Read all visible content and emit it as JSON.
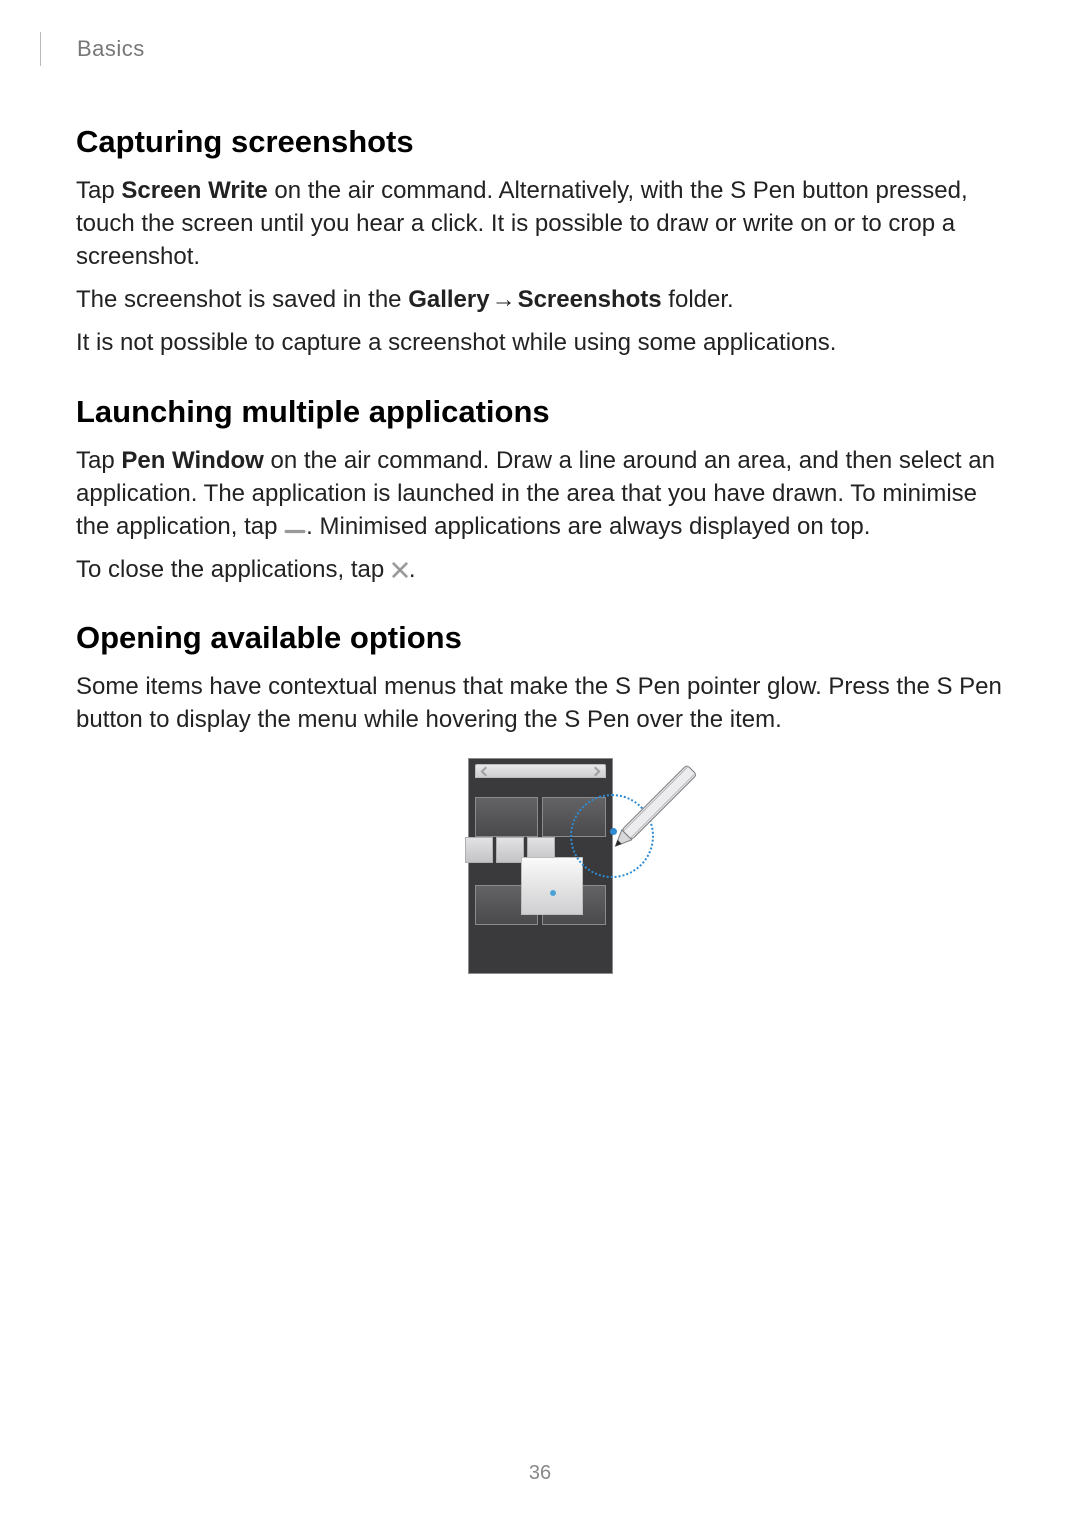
{
  "breadcrumb": "Basics",
  "sections": {
    "capture": {
      "heading": "Capturing screenshots",
      "p1_pre": "Tap ",
      "p1_bold": "Screen Write",
      "p1_post": " on the air command. Alternatively, with the S Pen button pressed, touch the screen until you hear a click. It is possible to draw or write on or to crop a screenshot.",
      "p2_pre": "The screenshot is saved in the ",
      "p2_b1": "Gallery",
      "p2_arrow": " → ",
      "p2_b2": "Screenshots",
      "p2_post": " folder.",
      "p3": "It is not possible to capture a screenshot while using some applications."
    },
    "launch": {
      "heading": "Launching multiple applications",
      "p1_pre": "Tap ",
      "p1_bold": "Pen Window",
      "p1_mid": " on the air command. Draw a line around an area, and then select an application. The application is launched in the area that you have drawn. To minimise the application, tap ",
      "p1_post": ". Minimised applications are always displayed on top.",
      "p2_pre": "To close the applications, tap ",
      "p2_post": "."
    },
    "options": {
      "heading": "Opening available options",
      "p1": "Some items have contextual menus that make the S Pen pointer glow. Press the S Pen button to display the menu while hovering the S Pen over the item."
    }
  },
  "page_number": "36"
}
